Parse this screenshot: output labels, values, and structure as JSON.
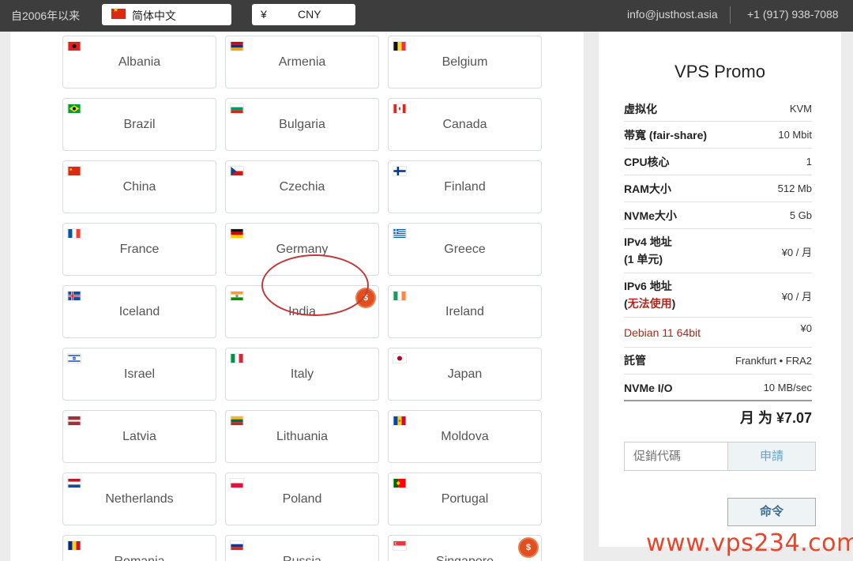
{
  "topbar": {
    "since": "自2006年以来",
    "language": "简体中文",
    "currency_symbol": "¥",
    "currency": "CNY",
    "email": "info@justhost.asia",
    "phone": "+1 (917) 938-7088"
  },
  "countries": [
    {
      "name": "Albania",
      "flag": "albania-flag"
    },
    {
      "name": "Armenia",
      "flag": "armenia-flag"
    },
    {
      "name": "Belgium",
      "flag": "belgium-flag"
    },
    {
      "name": "Brazil",
      "flag": "brazil-flag"
    },
    {
      "name": "Bulgaria",
      "flag": "bulgaria-flag"
    },
    {
      "name": "Canada",
      "flag": "canada-flag"
    },
    {
      "name": "China",
      "flag": "china-flag"
    },
    {
      "name": "Czechia",
      "flag": "czechia-flag"
    },
    {
      "name": "Finland",
      "flag": "finland-flag"
    },
    {
      "name": "France",
      "flag": "france-flag"
    },
    {
      "name": "Germany",
      "flag": "germany-flag",
      "selected": true
    },
    {
      "name": "Greece",
      "flag": "greece-flag"
    },
    {
      "name": "Iceland",
      "flag": "iceland-flag"
    },
    {
      "name": "India",
      "flag": "india-flag",
      "badge": "$"
    },
    {
      "name": "Ireland",
      "flag": "ireland-flag"
    },
    {
      "name": "Israel",
      "flag": "israel-flag"
    },
    {
      "name": "Italy",
      "flag": "italy-flag"
    },
    {
      "name": "Japan",
      "flag": "japan-flag"
    },
    {
      "name": "Latvia",
      "flag": "latvia-flag"
    },
    {
      "name": "Lithuania",
      "flag": "lithuania-flag"
    },
    {
      "name": "Moldova",
      "flag": "moldova-flag"
    },
    {
      "name": "Netherlands",
      "flag": "netherlands-flag"
    },
    {
      "name": "Poland",
      "flag": "poland-flag"
    },
    {
      "name": "Portugal",
      "flag": "portugal-flag"
    },
    {
      "name": "Romania",
      "flag": "romania-flag"
    },
    {
      "name": "Russia",
      "flag": "russia-flag"
    },
    {
      "name": "Singapore",
      "flag": "singapore-flag",
      "badge": "$"
    }
  ],
  "promo": {
    "title": "VPS Promo",
    "specs": [
      {
        "key": "虚拟化",
        "value": "KVM"
      },
      {
        "key": "帯寬 (fair-share)",
        "value": "10 Mbit"
      },
      {
        "key": "CPU核心",
        "value": "1"
      },
      {
        "key": "RAM大小",
        "value": "512 Mb"
      },
      {
        "key": "NVMe大小",
        "value": "5 Gb"
      },
      {
        "key": "IPv4 地址",
        "key_line2": "(1 单元)",
        "value": "¥0 / 月"
      },
      {
        "key": "IPv6 地址",
        "key_line2_open": "(",
        "key_line2_red": "无法使用",
        "key_line2_close": ")",
        "value": "¥0 / 月"
      },
      {
        "key": "Debian 11 64bit",
        "value": "¥0"
      },
      {
        "key": "託管",
        "value": "Frankfurt • FRA2"
      },
      {
        "key": "NVMe I/O",
        "value": "10 MB/sec"
      }
    ],
    "total": "月 为 ¥7.07",
    "promo_placeholder": "促銷代碼",
    "apply_label": "申請",
    "order_label": "命令"
  },
  "watermark": "www.vps234.com"
}
